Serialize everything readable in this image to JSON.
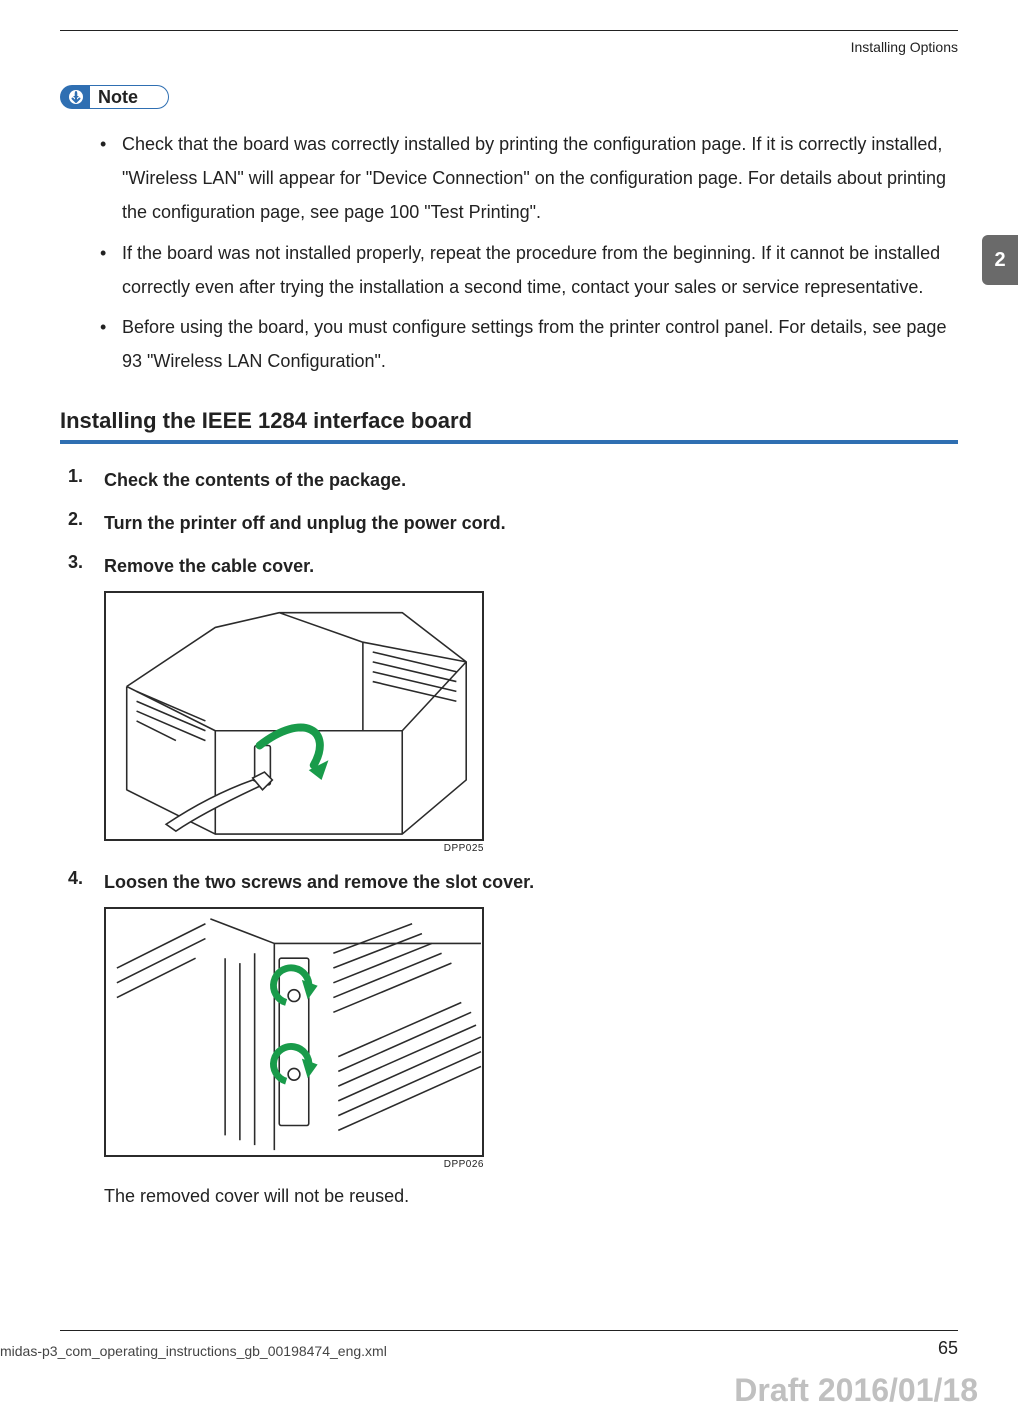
{
  "running_head": "Installing Options",
  "note_label": "Note",
  "note_items": [
    "Check that the board was correctly installed by printing the configuration page. If it is correctly installed, \"Wireless LAN\" will appear for \"Device Connection\" on the configuration page. For details about printing the configuration page, see page 100 \"Test Printing\".",
    "If the board was not installed properly, repeat the procedure from the beginning. If it cannot be installed correctly even after trying the installation a second time, contact your sales or service representative.",
    "Before using the board, you must configure settings from the printer control panel. For details, see page 93 \"Wireless LAN Configuration\"."
  ],
  "section_title": "Installing the IEEE 1284 interface board",
  "steps": [
    {
      "head": "Check the contents of the package."
    },
    {
      "head": "Turn the printer off and unplug the power cord."
    },
    {
      "head": "Remove the cable cover.",
      "fig_caption": "DPP025"
    },
    {
      "head": "Loosen the two screws and remove the slot cover.",
      "fig_caption": "DPP026",
      "body": "The removed cover will not be reused."
    }
  ],
  "side_tab": "2",
  "footer_file": "midas-p3_com_operating_instructions_gb_00198474_eng.xml",
  "page_number": "65",
  "draft_stamp": "Draft 2016/01/18"
}
